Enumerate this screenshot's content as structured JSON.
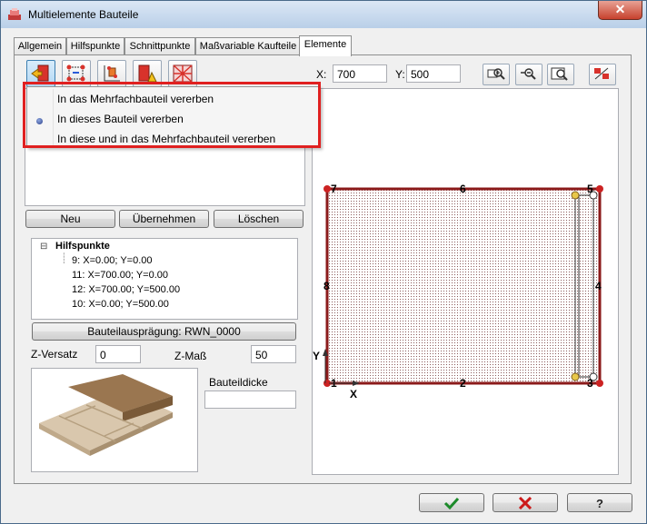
{
  "window": {
    "title": "Multielemente Bauteile",
    "close_label": "✕"
  },
  "tabs": [
    "Allgemein",
    "Hilfspunkte",
    "Schnittpunkte",
    "Maßvariable Kaufteile",
    "Elemente"
  ],
  "coords": {
    "x_label": "X:",
    "x_value": "700",
    "y_label": "Y:",
    "y_value": "500"
  },
  "context_menu": {
    "items": [
      {
        "label": "In das Mehrfachbauteil vererben",
        "selected": false
      },
      {
        "label": "In dieses Bauteil vererben",
        "selected": true
      },
      {
        "label": "In diese und in das Mehrfachbauteil vererben",
        "selected": false
      }
    ]
  },
  "buttons": {
    "new": "Neu",
    "take": "Übernehmen",
    "delete": "Löschen",
    "variant": "Bauteilausprägung: RWN_0000"
  },
  "tree": {
    "root": "Hilfspunkte",
    "expander": "⊟",
    "items": [
      "9: X=0.00; Y=0.00",
      "11: X=700.00; Y=0.00",
      "12: X=700.00; Y=500.00",
      "10: X=0.00; Y=500.00"
    ]
  },
  "offsets": {
    "z_offset_label": "Z-Versatz",
    "z_offset_value": "0",
    "z_dim_label": "Z-Maß",
    "z_dim_value": "50",
    "thickness_label": "Bauteildicke",
    "thickness_value": ""
  },
  "drawing": {
    "corner_labels": [
      "7",
      "6",
      "5",
      "8",
      "4",
      "1",
      "2",
      "3"
    ],
    "axis_y": "Y",
    "axis_x": "X",
    "frame_color": "#8b1a1a",
    "point_color": "#cc2222",
    "helper_point_color": "#e8c84a"
  },
  "footer": {
    "ok_icon": "check-icon",
    "cancel_icon": "x-icon",
    "help_icon": "question-icon"
  }
}
